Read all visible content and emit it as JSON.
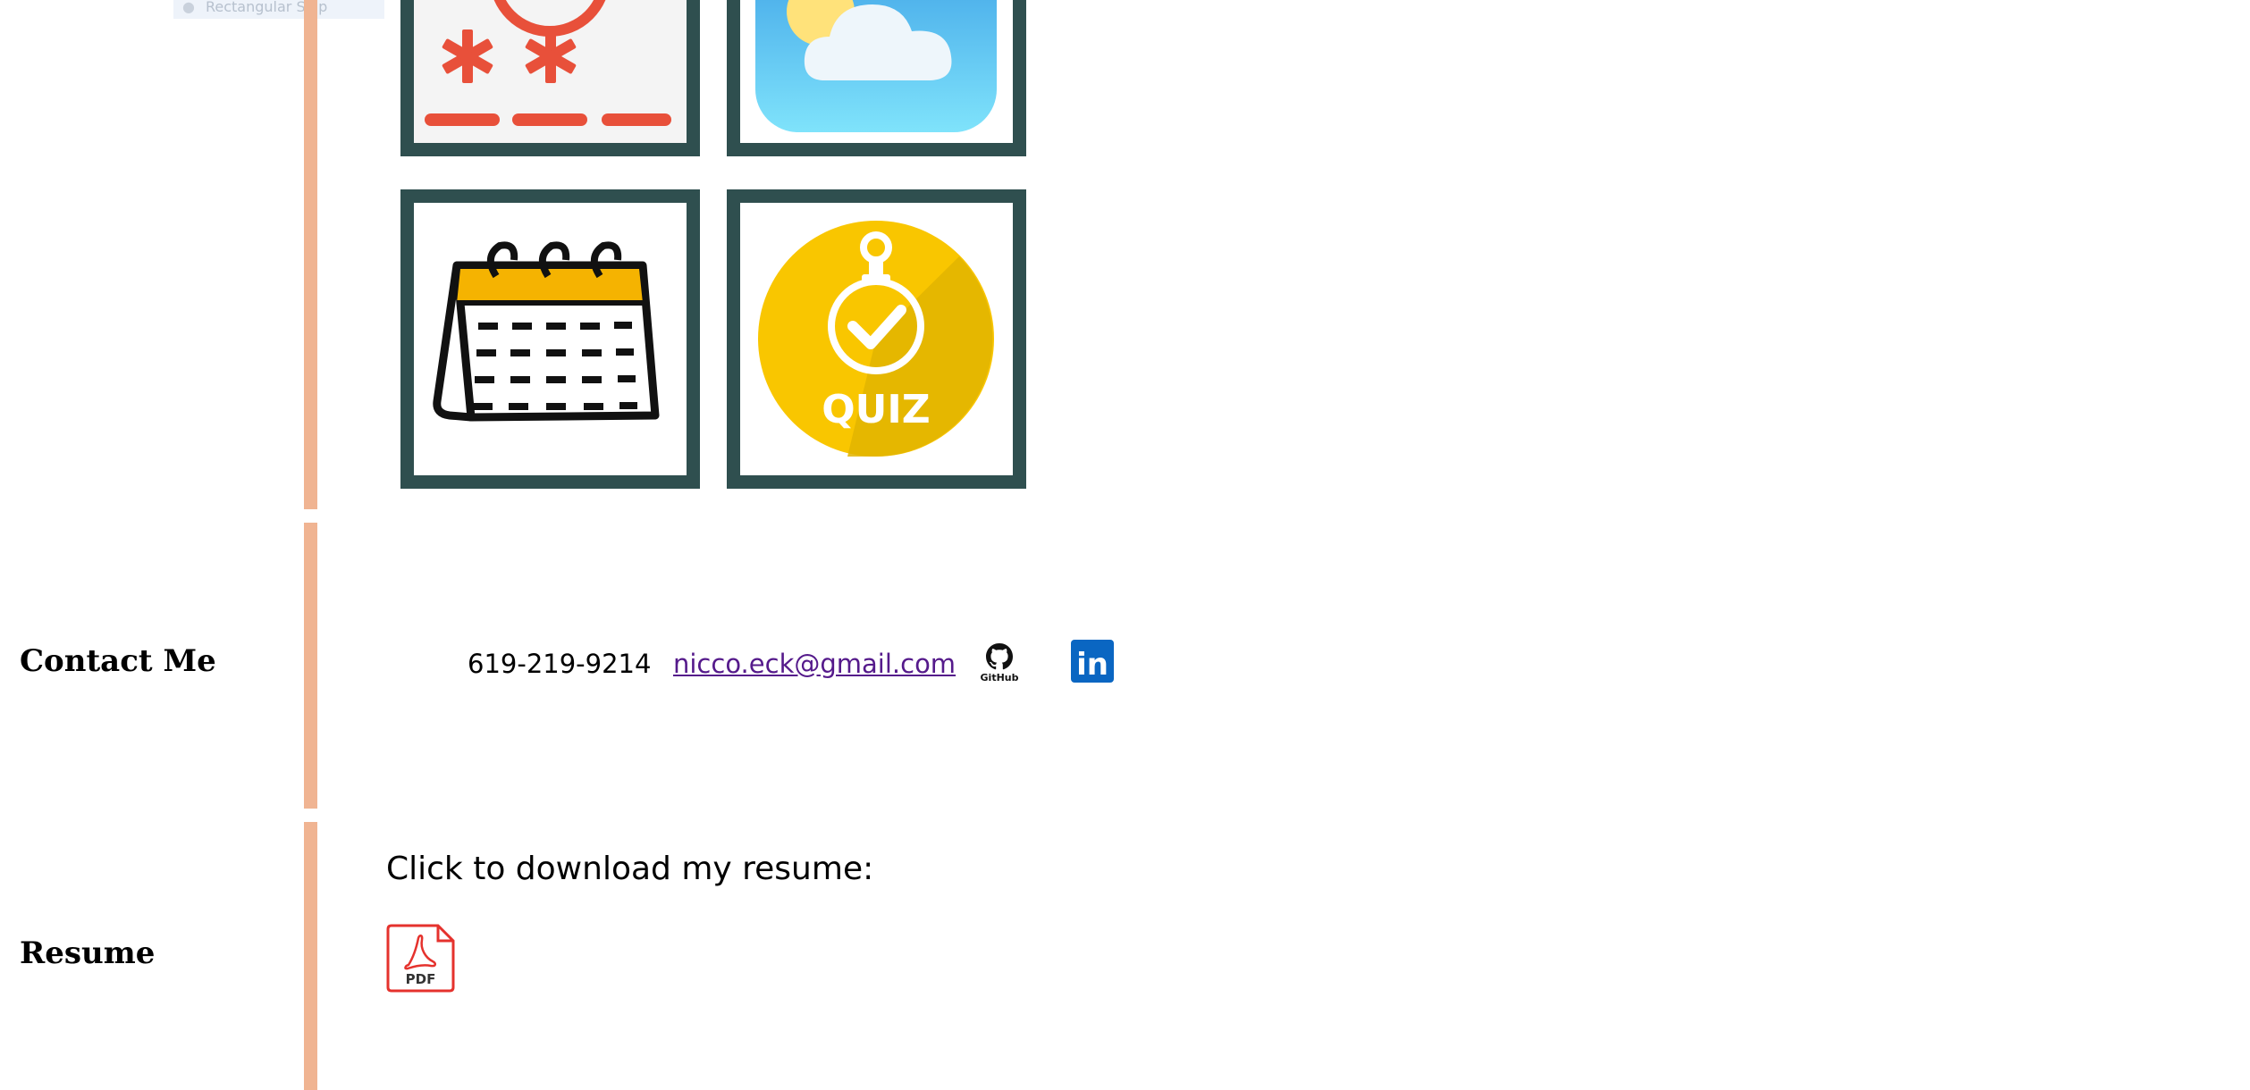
{
  "tooltip": {
    "text": "Rectangular Snip"
  },
  "projects": {
    "tiles": [
      {
        "name": "password-generator",
        "icon": "password-icon"
      },
      {
        "name": "weather-dashboard",
        "icon": "weather-icon"
      },
      {
        "name": "work-day-scheduler",
        "icon": "calendar-icon"
      },
      {
        "name": "code-quiz",
        "icon": "quiz-icon",
        "label": "QUIZ"
      }
    ]
  },
  "contact": {
    "heading": "Contact Me",
    "phone": "619-219-9214",
    "email": "nicco.eck@gmail.com",
    "github_label": "GitHub",
    "linkedin_label": "in"
  },
  "resume": {
    "heading": "Resume",
    "prompt": "Click to download my resume:",
    "pdf_label": "PDF"
  },
  "colors": {
    "accent_bar": "#f0b492",
    "tile_border": "#2f4f4f",
    "link": "#551a8b",
    "linkedin": "#0a66c2",
    "pdf_red": "#e5322d",
    "quiz_yellow": "#f9c600"
  }
}
